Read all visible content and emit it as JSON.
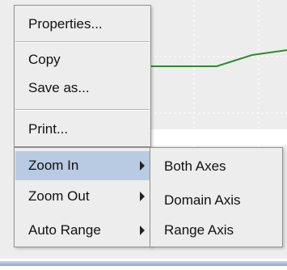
{
  "context_menu": {
    "items": [
      {
        "label": "Properties..."
      },
      {
        "label": "Copy"
      },
      {
        "label": "Save as..."
      },
      {
        "label": "Print..."
      },
      {
        "label": "Zoom In",
        "has_submenu": true,
        "highlighted": true
      },
      {
        "label": "Zoom Out",
        "has_submenu": true
      },
      {
        "label": "Auto Range",
        "has_submenu": true
      }
    ]
  },
  "zoom_submenu": {
    "items": [
      {
        "label": "Both Axes"
      },
      {
        "label": "Domain Axis"
      },
      {
        "label": "Range Axis"
      }
    ]
  },
  "colors": {
    "series_line": "#2e8b2e",
    "highlight": "#b9cbe3"
  }
}
